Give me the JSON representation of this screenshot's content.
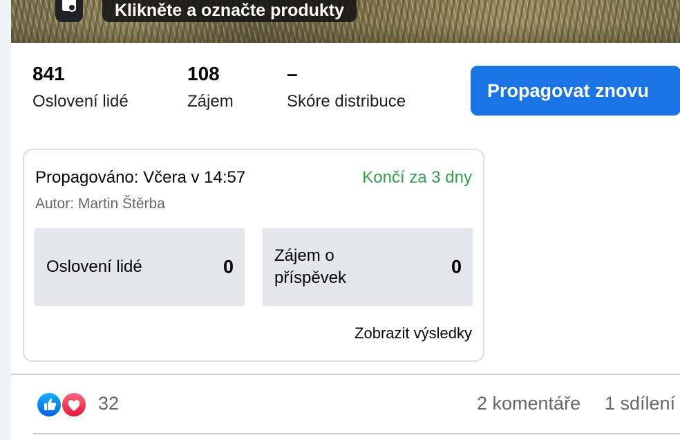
{
  "photo": {
    "tag_banner_text": "Klikněte a označte produkty"
  },
  "stats": [
    {
      "value": "841",
      "label": "Oslovení lidé"
    },
    {
      "value": "108",
      "label": "Zájem"
    },
    {
      "value": "–",
      "label": "Skóre distribuce"
    }
  ],
  "promote_button": "Propagovat znovu",
  "promotion": {
    "promoted_when": "Propagováno: Včera v 14:57",
    "ends_in": "Končí za 3 dny",
    "author": "Autor: Martin Štěrba",
    "metrics": [
      {
        "label": "Oslovení lidé",
        "value": "0"
      },
      {
        "label": "Zájem o příspěvek",
        "value": "0"
      }
    ],
    "results_link": "Zobrazit výsledky"
  },
  "reactions": {
    "count": "32",
    "icons": [
      "like-icon",
      "love-icon"
    ],
    "comments": "2 komentáře",
    "shares": "1 sdílení"
  },
  "colors": {
    "accent": "#1b74e4",
    "ends_green": "#31a24c",
    "muted": "#65676b"
  }
}
